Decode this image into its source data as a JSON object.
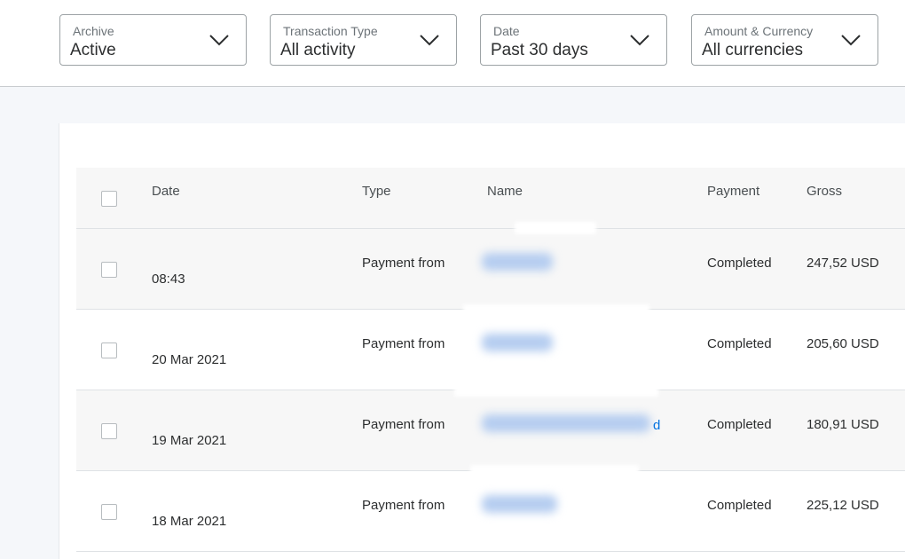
{
  "filters": [
    {
      "label": "Archive",
      "value": "Active"
    },
    {
      "label": "Transaction Type",
      "value": "All activity"
    },
    {
      "label": "Date",
      "value": "Past 30 days"
    },
    {
      "label": "Amount & Currency",
      "value": "All currencies"
    }
  ],
  "table": {
    "headers": {
      "date": "Date",
      "type": "Type",
      "name": "Name",
      "payment": "Payment",
      "gross": "Gross"
    },
    "rows": [
      {
        "date": "08:43",
        "type": "Payment from",
        "payment": "Completed",
        "gross": "247,52 USD",
        "name_tail": ""
      },
      {
        "date": "20 Mar 2021",
        "type": "Payment from",
        "payment": "Completed",
        "gross": "205,60 USD",
        "name_tail": ""
      },
      {
        "date": "19 Mar 2021",
        "type": "Payment from",
        "payment": "Completed",
        "gross": "180,91 USD",
        "name_tail": "d"
      },
      {
        "date": "18 Mar 2021",
        "type": "Payment from",
        "payment": "Completed",
        "gross": "225,12 USD",
        "name_tail": ""
      }
    ]
  },
  "colors": {
    "accent_link": "#0070e0",
    "row_alt": "#f7f7f7",
    "page_bg": "#f5f7fa"
  }
}
